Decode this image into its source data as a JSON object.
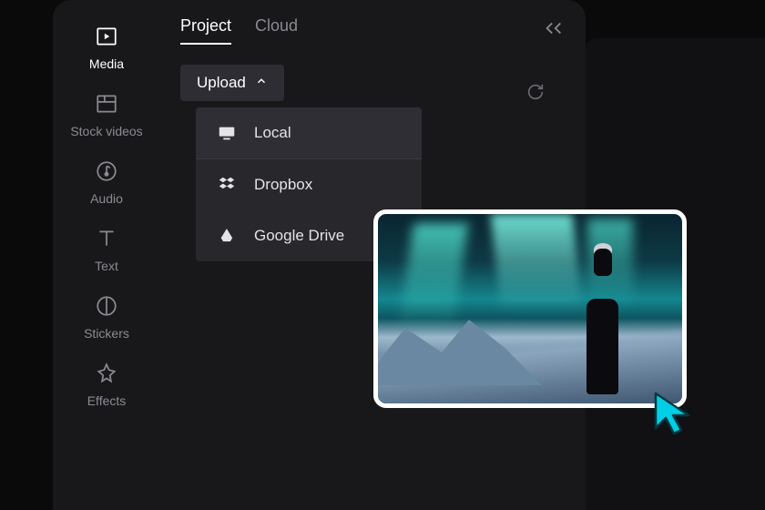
{
  "sidebar": {
    "items": [
      {
        "label": "Media",
        "icon": "media-icon",
        "active": true
      },
      {
        "label": "Stock videos",
        "icon": "stockvideo-icon",
        "active": false
      },
      {
        "label": "Audio",
        "icon": "audio-icon",
        "active": false
      },
      {
        "label": "Text",
        "icon": "text-icon",
        "active": false
      },
      {
        "label": "Stickers",
        "icon": "stickers-icon",
        "active": false
      },
      {
        "label": "Effects",
        "icon": "effects-icon",
        "active": false
      }
    ]
  },
  "tabs": {
    "project": "Project",
    "cloud": "Cloud",
    "active": "project"
  },
  "upload": {
    "label": "Upload",
    "options": [
      {
        "label": "Local",
        "icon": "local-icon"
      },
      {
        "label": "Dropbox",
        "icon": "dropbox-icon"
      },
      {
        "label": "Google Drive",
        "icon": "googledrive-icon"
      }
    ]
  },
  "thumbnail": {
    "description": "Person silhouette standing before aurora borealis over snowy mountains"
  },
  "colors": {
    "accent": "#00d0e6",
    "panel": "#18181b",
    "dropdown": "#27272c",
    "text_muted": "#8a8a92"
  }
}
